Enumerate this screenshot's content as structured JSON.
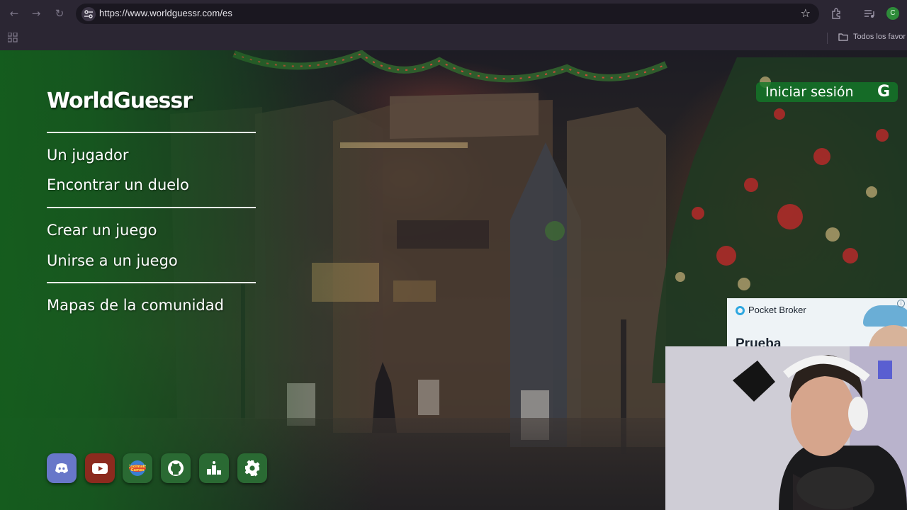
{
  "browser": {
    "url": "https://www.worldguessr.com/es",
    "profile_initial": "C",
    "bookmarks_label": "Todos los favor"
  },
  "site": {
    "logo": "WorldGuessr",
    "login_label": "Iniciar sesión",
    "login_icon": "G",
    "menu_group_1": [
      "Un jugador",
      "Encontrar un duelo"
    ],
    "menu_group_2": [
      "Crear un juego",
      "Unirse a un juego"
    ],
    "menu_group_3": [
      "Mapas de la comunidad"
    ],
    "social": [
      {
        "icon": "discord-icon",
        "color": "#6877c9"
      },
      {
        "icon": "youtube-icon",
        "color": "#8c2a1e"
      },
      {
        "icon": "coolmath-games-icon",
        "color": "#2a6a33"
      },
      {
        "icon": "github-icon",
        "color": "#2a6a33"
      },
      {
        "icon": "leaderboard-icon",
        "color": "#2a6a33"
      },
      {
        "icon": "settings-icon",
        "color": "#2a6a33"
      }
    ],
    "social_icon_text": {
      "coolmath": "Coolmath Games"
    }
  },
  "ad": {
    "brand": "Pocket Broker",
    "headline": "Prueba",
    "info_icon": "i"
  },
  "colors": {
    "chrome_bg": "#2b2633",
    "overlay_green": "#145f1e",
    "login_green": "#14782a"
  }
}
